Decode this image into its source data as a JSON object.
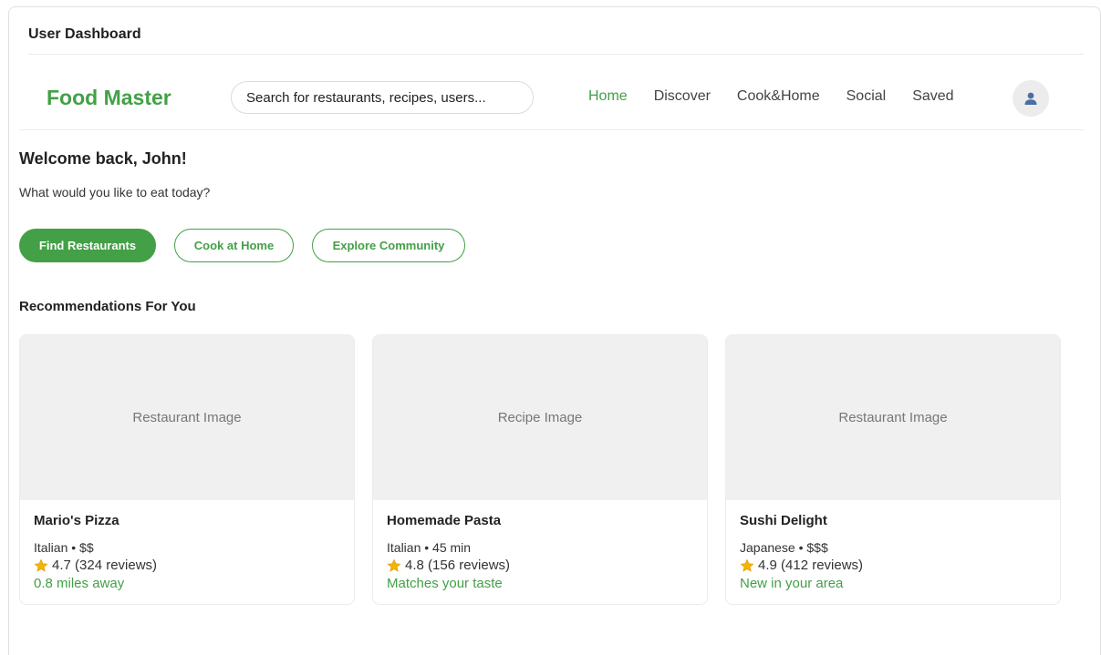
{
  "window": {
    "title": "User Dashboard"
  },
  "header": {
    "brand": "Food Master",
    "search": {
      "placeholder": "Search for restaurants, recipes, users...",
      "value": ""
    },
    "nav": [
      {
        "label": "Home",
        "active": true
      },
      {
        "label": "Discover",
        "active": false
      },
      {
        "label": "Cook&Home",
        "active": false
      },
      {
        "label": "Social",
        "active": false
      },
      {
        "label": "Saved",
        "active": false
      }
    ],
    "avatar_icon": "user-icon"
  },
  "welcome": {
    "title": "Welcome back, John!",
    "subtitle": "What would you like to eat today?"
  },
  "actions": {
    "find_restaurants": "Find Restaurants",
    "cook_at_home": "Cook at Home",
    "explore_community": "Explore Community"
  },
  "recommendations": {
    "title": "Recommendations For You",
    "cards": [
      {
        "image_label": "Restaurant Image",
        "name": "Mario's Pizza",
        "meta": "Italian • $$",
        "rating": "4.7 (324 reviews)",
        "note": "0.8 miles away"
      },
      {
        "image_label": "Recipe Image",
        "name": "Homemade Pasta",
        "meta": "Italian • 45 min",
        "rating": "4.8 (156 reviews)",
        "note": "Matches your taste"
      },
      {
        "image_label": "Restaurant Image",
        "name": "Sushi Delight",
        "meta": "Japanese • $$$",
        "rating": "4.9 (412 reviews)",
        "note": "New in your area"
      }
    ]
  },
  "colors": {
    "accent": "#43a047",
    "star": "#f4b400"
  }
}
